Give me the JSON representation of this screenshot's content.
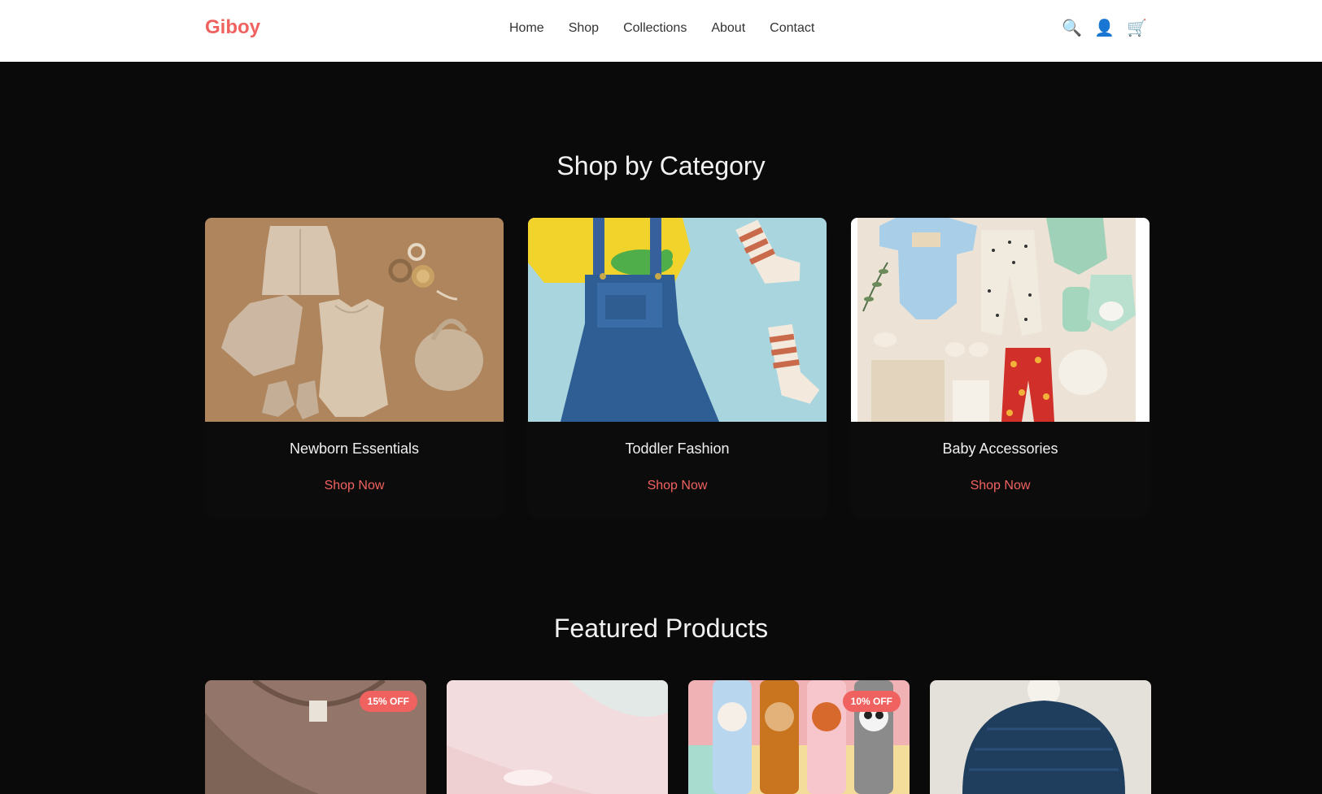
{
  "brand": {
    "name": "Giboy",
    "color": "#f0625f"
  },
  "nav": {
    "items": [
      "Home",
      "Shop",
      "Collections",
      "About",
      "Contact"
    ]
  },
  "header_icons": {
    "search": "search-icon",
    "account": "user-icon",
    "cart": "cart-icon"
  },
  "categories_section": {
    "title": "Shop by Category",
    "items": [
      {
        "name": "Newborn Essentials",
        "link": "Shop Now",
        "image": "neutral knit baby clothes flat-lay"
      },
      {
        "name": "Toddler Fashion",
        "link": "Shop Now",
        "image": "denim overalls with yellow tee and striped socks"
      },
      {
        "name": "Baby Accessories",
        "link": "Shop Now",
        "image": "pastel baby outfits and bibs flat-lay"
      }
    ]
  },
  "featured_section": {
    "title": "Featured Products",
    "products": [
      {
        "badge": "15% OFF",
        "image": "brown baby tee"
      },
      {
        "badge": "",
        "image": "pink baby blanket"
      },
      {
        "badge": "10% OFF",
        "image": "animal character socks"
      },
      {
        "badge": "",
        "image": "navy knit pom-pom hat"
      }
    ]
  },
  "colors": {
    "accent": "#f0625f",
    "page_background": "#0a0a0b",
    "header_background": "#ffffff"
  }
}
